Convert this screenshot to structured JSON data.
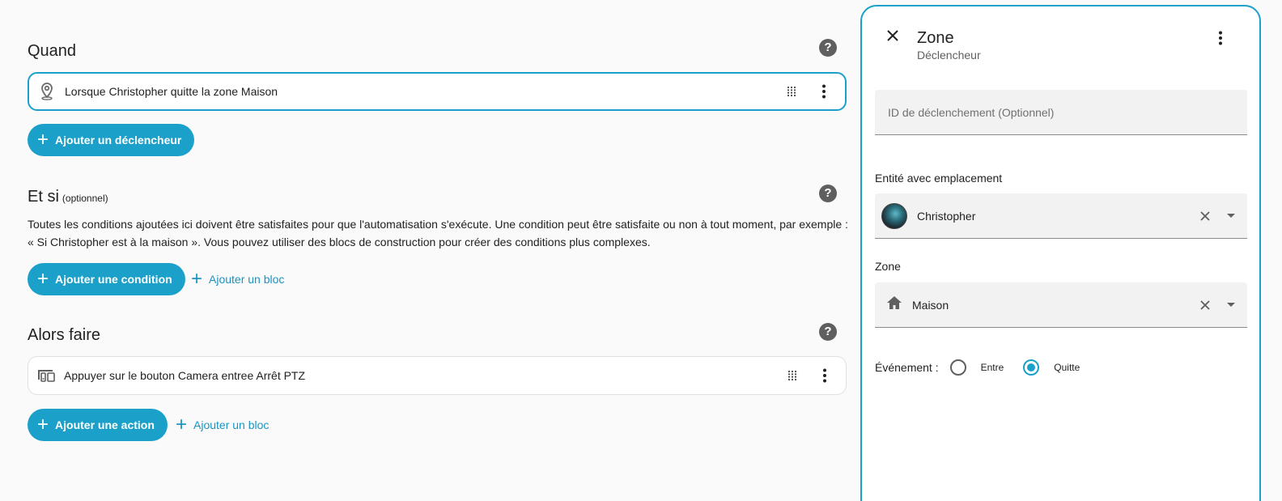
{
  "when": {
    "title": "Quand",
    "trigger_label": "Lorsque Christopher quitte la zone Maison",
    "add_trigger": "Ajouter un déclencheur"
  },
  "if": {
    "title": "Et si",
    "optional": "(optionnel)",
    "description_line1": "Toutes les conditions ajoutées ici doivent être satisfaites pour que l'automatisation s'exécute. Une condition peut être satisfaite ou non à tout moment, par exemple :",
    "description_line2": "« Si Christopher est à la maison ». Vous pouvez utiliser des blocs de construction pour créer des conditions plus complexes.",
    "add_condition": "Ajouter une condition",
    "add_block": "Ajouter un bloc"
  },
  "then": {
    "title": "Alors faire",
    "action_label": "Appuyer sur le bouton Camera entree Arrêt PTZ",
    "add_action": "Ajouter une action",
    "add_block": "Ajouter un bloc"
  },
  "help_glyph": "?",
  "plus_glyph": "+",
  "panel": {
    "title": "Zone",
    "subtitle": "Déclencheur",
    "trigger_id_placeholder": "ID de déclenchement (Optionnel)",
    "entity_label": "Entité avec emplacement",
    "entity_value": "Christopher",
    "zone_label": "Zone",
    "zone_value": "Maison",
    "event_label": "Événement :",
    "event_enter": "Entre",
    "event_leave": "Quitte",
    "selected_event": "Quitte"
  },
  "colors": {
    "accent": "#1ba1c9",
    "background": "#fafafa"
  },
  "icons": [
    "map-marker-icon",
    "drag-handle-icon",
    "more-vert-icon",
    "help-icon",
    "plus-icon",
    "devices-icon",
    "close-icon",
    "clear-icon",
    "dropdown-arrow-icon",
    "home-icon"
  ]
}
